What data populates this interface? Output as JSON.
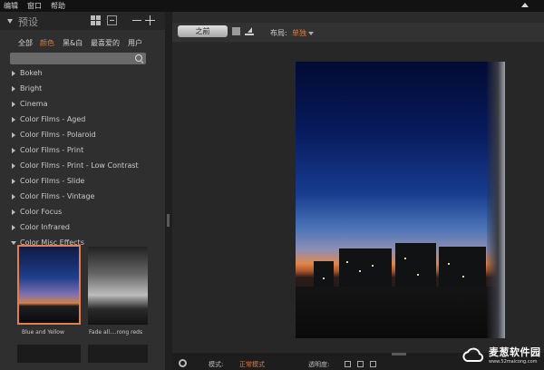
{
  "menubar": {
    "items": [
      "编辑",
      "窗口",
      "帮助"
    ]
  },
  "presets_panel": {
    "title": "预设",
    "icons": [
      "grid-view-icon",
      "expand-icon",
      "minus-icon",
      "plus-icon"
    ],
    "categories": [
      {
        "label": "全部",
        "active": false
      },
      {
        "label": "颜色",
        "active": true
      },
      {
        "label": "黑&白",
        "active": false
      },
      {
        "label": "最喜爱的",
        "active": false
      },
      {
        "label": "用户",
        "active": false
      }
    ],
    "search_placeholder": "",
    "items": [
      {
        "label": "Bokeh",
        "expanded": false
      },
      {
        "label": "Bright",
        "expanded": false
      },
      {
        "label": "Cinema",
        "expanded": false
      },
      {
        "label": "Color Films - Aged",
        "expanded": false
      },
      {
        "label": "Color Films - Polaroid",
        "expanded": false
      },
      {
        "label": "Color Films - Print",
        "expanded": false
      },
      {
        "label": "Color Films - Print - Low Contrast",
        "expanded": false
      },
      {
        "label": "Color Films - Slide",
        "expanded": false
      },
      {
        "label": "Color Films - Vintage",
        "expanded": false
      },
      {
        "label": "Color Focus",
        "expanded": false
      },
      {
        "label": "Color Infrared",
        "expanded": false
      },
      {
        "label": "Color Misc Effects",
        "expanded": true
      }
    ],
    "thumbnails": [
      {
        "caption": "Blue and Yellow",
        "selected": true
      },
      {
        "caption": "Fade all....rong reds",
        "selected": false
      }
    ]
  },
  "toolbar": {
    "before_button": "之前",
    "layout_label": "布局:",
    "layout_value": "单独"
  },
  "bottom_bar": {
    "label1": "模式:",
    "value1": "正常模式",
    "label2": "透明度:"
  },
  "watermark": {
    "name": "麦葱软件园",
    "url": "www.52maicong.com"
  },
  "colors": {
    "accent": "#e07a3c",
    "panel_bg": "#2f2f2f",
    "canvas_bg": "#272727"
  }
}
